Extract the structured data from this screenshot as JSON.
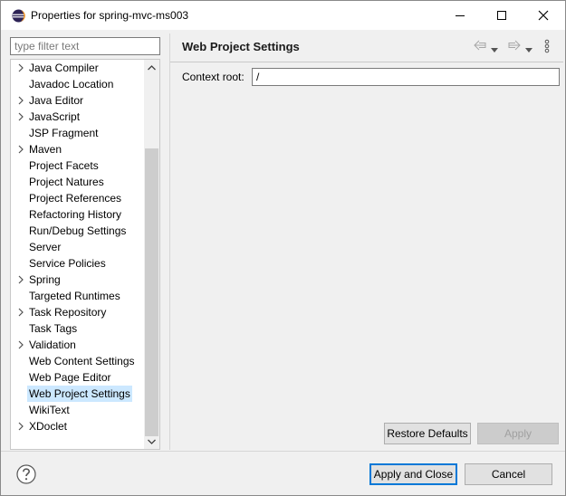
{
  "window": {
    "title": "Properties for spring-mvc-ms003",
    "app_icon": "eclipse-icon",
    "controls": [
      "minimize-icon",
      "maximize-icon",
      "close-icon"
    ]
  },
  "filter": {
    "placeholder": "type filter text",
    "value": ""
  },
  "tree": {
    "items": [
      {
        "label": "Java Compiler",
        "expandable": true
      },
      {
        "label": "Javadoc Location",
        "expandable": false
      },
      {
        "label": "Java Editor",
        "expandable": true
      },
      {
        "label": "JavaScript",
        "expandable": true
      },
      {
        "label": "JSP Fragment",
        "expandable": false
      },
      {
        "label": "Maven",
        "expandable": true
      },
      {
        "label": "Project Facets",
        "expandable": false
      },
      {
        "label": "Project Natures",
        "expandable": false
      },
      {
        "label": "Project References",
        "expandable": false
      },
      {
        "label": "Refactoring History",
        "expandable": false
      },
      {
        "label": "Run/Debug Settings",
        "expandable": false
      },
      {
        "label": "Server",
        "expandable": false
      },
      {
        "label": "Service Policies",
        "expandable": false
      },
      {
        "label": "Spring",
        "expandable": true
      },
      {
        "label": "Targeted Runtimes",
        "expandable": false
      },
      {
        "label": "Task Repository",
        "expandable": true
      },
      {
        "label": "Task Tags",
        "expandable": false
      },
      {
        "label": "Validation",
        "expandable": true
      },
      {
        "label": "Web Content Settings",
        "expandable": false
      },
      {
        "label": "Web Page Editor",
        "expandable": false
      },
      {
        "label": "Web Project Settings",
        "expandable": false,
        "selected": true
      },
      {
        "label": "WikiText",
        "expandable": false
      },
      {
        "label": "XDoclet",
        "expandable": true
      }
    ]
  },
  "page": {
    "title": "Web Project Settings",
    "nav_icons": [
      "back-arrow-icon",
      "back-dropdown-icon",
      "forward-arrow-icon",
      "forward-dropdown-icon",
      "view-menu-icon"
    ],
    "context_root_label": "Context root:",
    "context_root_value": "/"
  },
  "buttons": {
    "restore_defaults": "Restore Defaults",
    "apply": "Apply",
    "apply_and_close": "Apply and Close",
    "cancel": "Cancel"
  },
  "footer": {
    "help_icon": "help-icon"
  },
  "colors": {
    "selection": "#cce8ff",
    "default_button_border": "#0078d7"
  }
}
